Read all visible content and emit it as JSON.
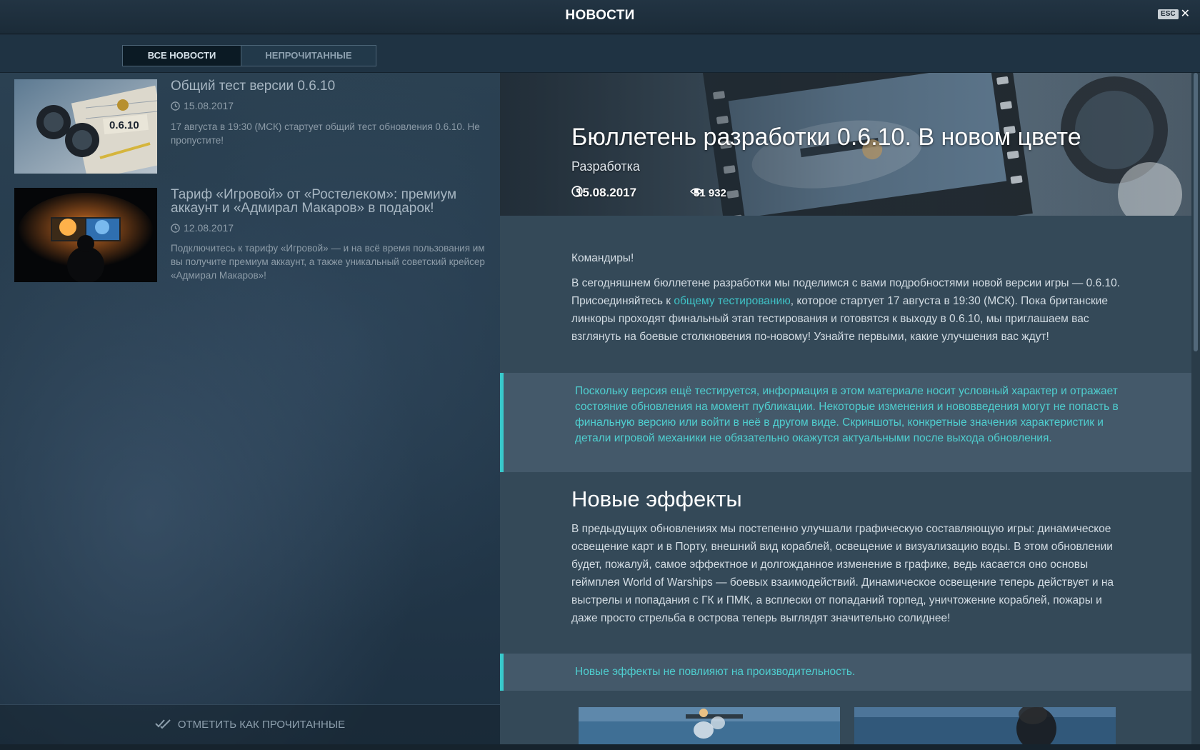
{
  "window": {
    "title": "НОВОСТИ",
    "esc_label": "ESC"
  },
  "tabs": [
    {
      "label": "ВСЕ НОВОСТИ",
      "active": true
    },
    {
      "label": "НЕПРОЧИТАННЫЕ",
      "active": false
    }
  ],
  "news_list": [
    {
      "title": "Общий тест версии 0.6.10",
      "date": "15.08.2017",
      "excerpt": "17 августа в 19:30 (МСК) стартует общий тест обновления 0.6.10. Не пропустите!",
      "thumb_label": "0.6.10"
    },
    {
      "title": "Тариф «Игровой» от «Ростелеком»: премиум аккаунт и «Адмирал Макаров» в подарок!",
      "date": "12.08.2017",
      "excerpt": "Подключитесь к тарифу «Игровой» — и на всё время пользования им вы получите премиум аккаунт, а также уникальный советский крейсер «Адмирал Макаров»!"
    }
  ],
  "mark_read_label": "ОТМЕТИТЬ КАК ПРОЧИТАННЫЕ",
  "article": {
    "title": "Бюллетень разработки 0.6.10. В новом цвете",
    "category": "Разработка",
    "date": "15.08.2017",
    "views": "51 932",
    "greeting": "Командиры!",
    "intro_before_link": "В сегодняшнем бюллетене разработки мы поделимся с вами подробностями новой версии игры — 0.6.10. Присоединяйтесь к ",
    "intro_link": "общему тестированию",
    "intro_after_link": ", которое стартует 17 августа в 19:30 (МСК). Пока британские линкоры проходят финальный этап тестирования и готовятся к выходу в 0.6.10, мы приглашаем вас взглянуть на боевые столкновения по-новому! Узнайте первыми, какие улучшения вас ждут!",
    "note1": "Поскольку версия ещё тестируется, информация в этом материале носит условный характер и отражает состояние обновления на момент публикации. Некоторые изменения и нововведения могут не попасть в финальную версию или войти в неё в другом виде. Скриншоты, конкретные значения характеристик и детали игровой механики не обязательно окажутся актуальными после выхода обновления.",
    "section_title": "Новые эффекты",
    "section_text": "В предыдущих обновлениях мы постепенно улучшали графическую составляющую игры: динамическое освещение карт и в Порту, внешний вид кораблей, освещение и визуализацию воды. В этом обновлении будет, пожалуй, самое эффектное и долгожданное изменение в графике, ведь касается оно основы геймплея World of Warships — боевых взаимодействий. Динамическое освещение теперь действует и на выстрелы и попадания с ГК и ПМК, а всплески от попаданий торпед, уничтожение кораблей, пожары и даже просто стрельба в острова теперь выглядят значительно солиднее!",
    "note2": "Новые эффекты не повлияют на производительность."
  },
  "colors": {
    "accent": "#38c9cc",
    "link": "#3fc3c7"
  }
}
